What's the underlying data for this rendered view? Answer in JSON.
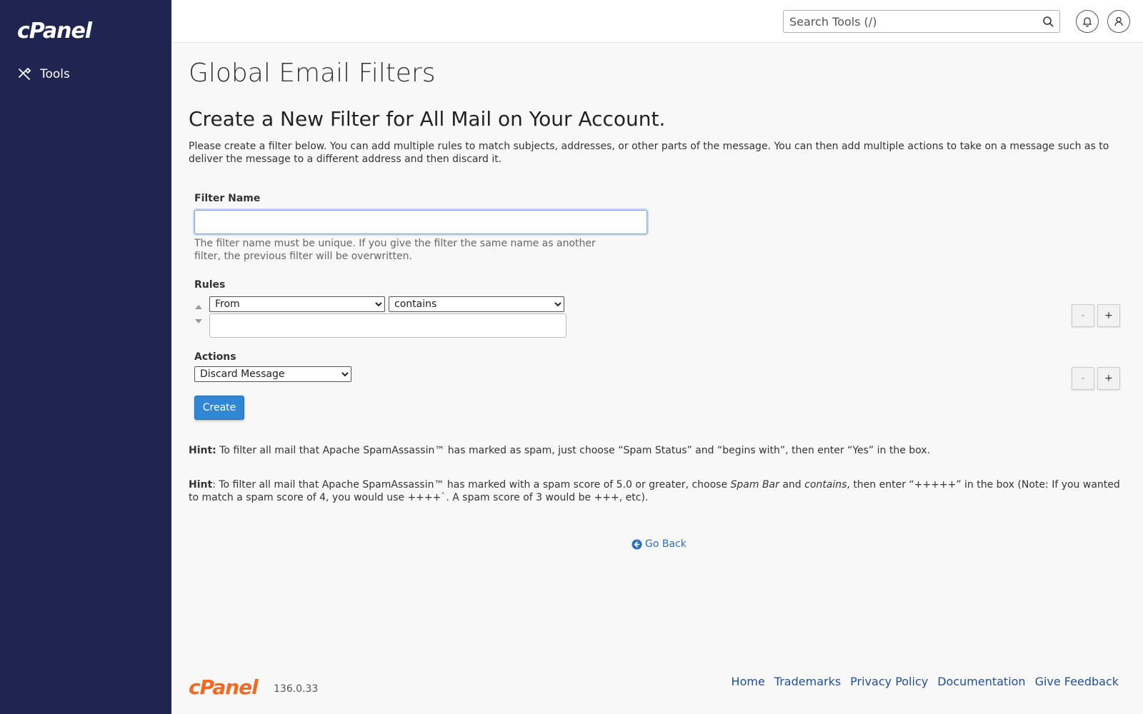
{
  "app": {
    "logo_text": "cPanel"
  },
  "sidebar": {
    "items": [
      {
        "label": "Tools",
        "icon": "tools-icon"
      }
    ]
  },
  "topbar": {
    "search_placeholder": "Search Tools (/)",
    "notification_icon": "bell-icon",
    "user_icon": "user-icon"
  },
  "page": {
    "title": "Global Email Filters",
    "subtitle": "Create a New Filter for All Mail on Your Account.",
    "description": "Please create a filter below. You can add multiple rules to match subjects, addresses, or other parts of the message. You can then add multiple actions to take on a message such as to deliver the message to a different address and then discard it."
  },
  "form": {
    "filter_name_label": "Filter Name",
    "filter_name_value": "",
    "filter_name_help": "The filter name must be unique. If you give the filter the same name as another filter, the previous filter will be overwritten.",
    "rules_label": "Rules",
    "rule_field_selected": "From",
    "rule_operator_selected": "contains",
    "rule_value": "",
    "actions_label": "Actions",
    "action_selected": "Discard Message",
    "minus_label": "-",
    "plus_label": "+",
    "create_label": "Create"
  },
  "hints": {
    "hint1_label": "Hint:",
    "hint1_text": " To filter all mail that Apache SpamAssassin™ has marked as spam, just choose “Spam Status” and “begins with”, then enter “Yes” in the box.",
    "hint2_label": "Hint",
    "hint2_part1": ": To filter all mail that Apache SpamAssassin™ has marked with a spam score of 5.0 or greater, choose ",
    "hint2_em1": "Spam Bar",
    "hint2_part2": " and ",
    "hint2_em2": "contains",
    "hint2_part3": ", then enter “+++++” in the box (Note: If you wanted to match a spam score of 4, you would use ++++`. A spam score of 3 would be +++, etc)."
  },
  "go_back_label": "Go Back",
  "footer": {
    "logo_text": "cPanel",
    "version": "136.0.33",
    "links": [
      "Home",
      "Trademarks",
      "Privacy Policy",
      "Documentation",
      "Give Feedback"
    ]
  },
  "colors": {
    "sidebar_bg": "#1f2451",
    "accent": "#2f87d6",
    "footer_logo": "#f06a24",
    "link": "#1f4f9e"
  }
}
